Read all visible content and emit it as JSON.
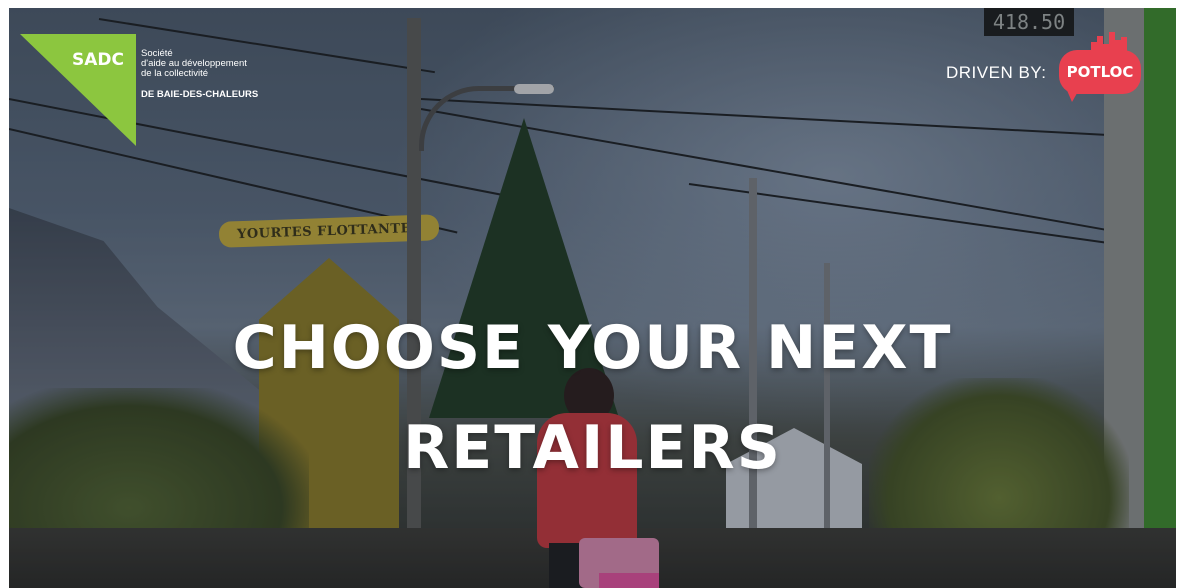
{
  "hero": {
    "headline_line1": "CHOOSE YOUR NEXT",
    "headline_line2": "RETAILERS",
    "background_description_icon": "street-photo-background"
  },
  "sadc_logo": {
    "mark": "SADC",
    "description_line1": "Société",
    "description_line2": "d'aide au développement",
    "description_line3": "de la collectivité",
    "region": "DE BAIE-DES-CHALEURS",
    "color": "#8cc63f"
  },
  "sponsor": {
    "driven_by_label": "DRIVEN BY:",
    "brand": "POTLOC",
    "brand_color": "#e8404f"
  },
  "scene": {
    "shop_sign": "YOURTES FLOTTANTES",
    "digital_display": "418.50"
  }
}
